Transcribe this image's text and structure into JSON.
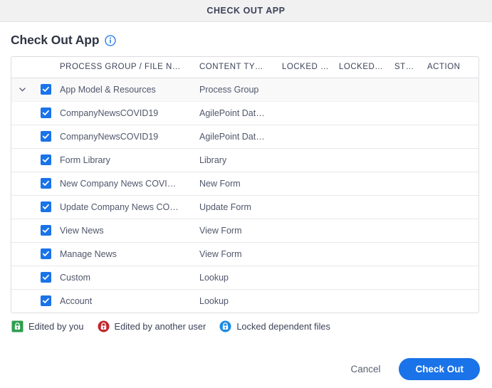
{
  "window": {
    "title": "CHECK OUT APP"
  },
  "page": {
    "heading": "Check Out App",
    "info_icon": "info-circle-icon"
  },
  "table": {
    "columns": [
      {
        "key": "toggle",
        "label": ""
      },
      {
        "key": "check",
        "label": ""
      },
      {
        "key": "name",
        "label": "PROCESS GROUP / FILE N…"
      },
      {
        "key": "type",
        "label": "CONTENT TY…"
      },
      {
        "key": "locked_by",
        "label": "LOCKED …"
      },
      {
        "key": "locked_date",
        "label": "LOCKED…"
      },
      {
        "key": "status",
        "label": "ST…"
      },
      {
        "key": "action",
        "label": "ACTION"
      }
    ],
    "rows": [
      {
        "expander": "chevron-down-icon",
        "checked": true,
        "name": "App Model & Resources",
        "type": "Process Group",
        "locked_by": "",
        "locked_date": "",
        "status": "",
        "action": ""
      },
      {
        "expander": "",
        "checked": true,
        "name": "CompanyNewsCOVID19",
        "type": "AgilePoint Dat…",
        "locked_by": "",
        "locked_date": "",
        "status": "",
        "action": ""
      },
      {
        "expander": "",
        "checked": true,
        "name": "CompanyNewsCOVID19",
        "type": "AgilePoint Dat…",
        "locked_by": "",
        "locked_date": "",
        "status": "",
        "action": ""
      },
      {
        "expander": "",
        "checked": true,
        "name": "Form Library",
        "type": "Library",
        "locked_by": "",
        "locked_date": "",
        "status": "",
        "action": ""
      },
      {
        "expander": "",
        "checked": true,
        "name": "New Company News COVI…",
        "type": "New Form",
        "locked_by": "",
        "locked_date": "",
        "status": "",
        "action": ""
      },
      {
        "expander": "",
        "checked": true,
        "name": "Update Company News CO…",
        "type": "Update Form",
        "locked_by": "",
        "locked_date": "",
        "status": "",
        "action": ""
      },
      {
        "expander": "",
        "checked": true,
        "name": "View News",
        "type": "View Form",
        "locked_by": "",
        "locked_date": "",
        "status": "",
        "action": ""
      },
      {
        "expander": "",
        "checked": true,
        "name": "Manage News",
        "type": "View Form",
        "locked_by": "",
        "locked_date": "",
        "status": "",
        "action": ""
      },
      {
        "expander": "",
        "checked": true,
        "name": "Custom",
        "type": "Lookup",
        "locked_by": "",
        "locked_date": "",
        "status": "",
        "action": ""
      },
      {
        "expander": "",
        "checked": true,
        "name": "Account",
        "type": "Lookup",
        "locked_by": "",
        "locked_date": "",
        "status": "",
        "action": ""
      }
    ]
  },
  "legend": [
    {
      "icon": "lock-square-green-icon",
      "label": "Edited by you",
      "color": "#2e9e4f"
    },
    {
      "icon": "lock-circle-red-icon",
      "label": "Edited by another user",
      "color": "#c1272d"
    },
    {
      "icon": "lock-circle-blue-icon",
      "label": "Locked dependent files",
      "color": "#1a8ae5"
    }
  ],
  "footer": {
    "cancel_label": "Cancel",
    "checkout_label": "Check Out"
  },
  "colors": {
    "accent": "#1a73e8",
    "titlebar_bg": "#f1f1f2",
    "row_highlight": "#f9f9fa",
    "border": "#dcdde1",
    "text": "#3c4257"
  }
}
